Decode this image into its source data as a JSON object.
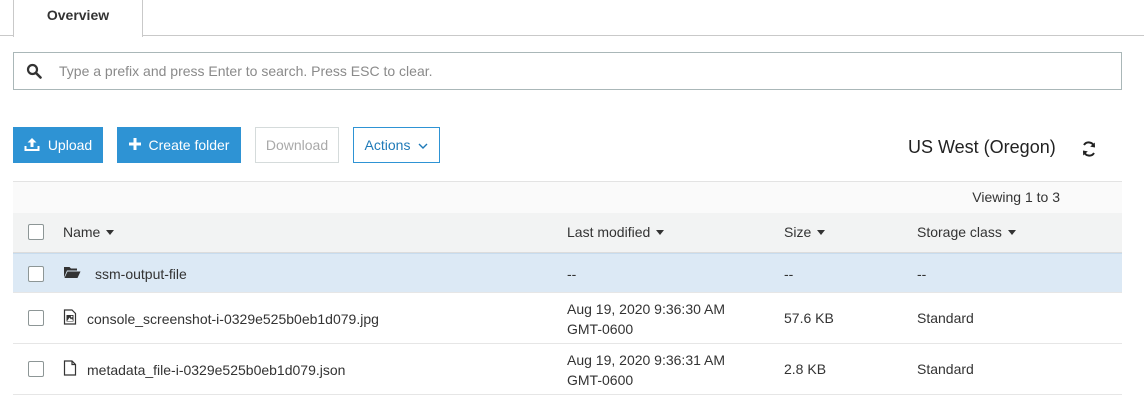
{
  "tabs": {
    "overview_label": "Overview"
  },
  "search": {
    "placeholder": "Type a prefix and press Enter to search. Press ESC to clear.",
    "value": ""
  },
  "toolbar": {
    "upload_label": "Upload",
    "create_folder_label": "Create folder",
    "download_label": "Download",
    "actions_label": "Actions",
    "region_label": "US West (Oregon)"
  },
  "table": {
    "viewing_text": "Viewing 1 to 3",
    "headers": {
      "name": "Name",
      "last_modified": "Last modified",
      "size": "Size",
      "storage_class": "Storage class"
    },
    "rows": [
      {
        "type": "folder",
        "name": "ssm-output-file",
        "modified_date": "--",
        "modified_tz": "",
        "size": "--",
        "storage_class": "--"
      },
      {
        "type": "image-file",
        "name": "console_screenshot-i-0329e525b0eb1d079.jpg",
        "modified_date": "Aug 19, 2020 9:36:30 AM",
        "modified_tz": "GMT-0600",
        "size": "57.6 KB",
        "storage_class": "Standard"
      },
      {
        "type": "file",
        "name": "metadata_file-i-0329e525b0eb1d079.json",
        "modified_date": "Aug 19, 2020 9:36:31 AM",
        "modified_tz": "GMT-0600",
        "size": "2.8 KB",
        "storage_class": "Standard"
      }
    ]
  },
  "colors": {
    "primary": "#2e93d4",
    "selected_row": "#dce9f5",
    "header_bg": "#f2f3f3"
  }
}
